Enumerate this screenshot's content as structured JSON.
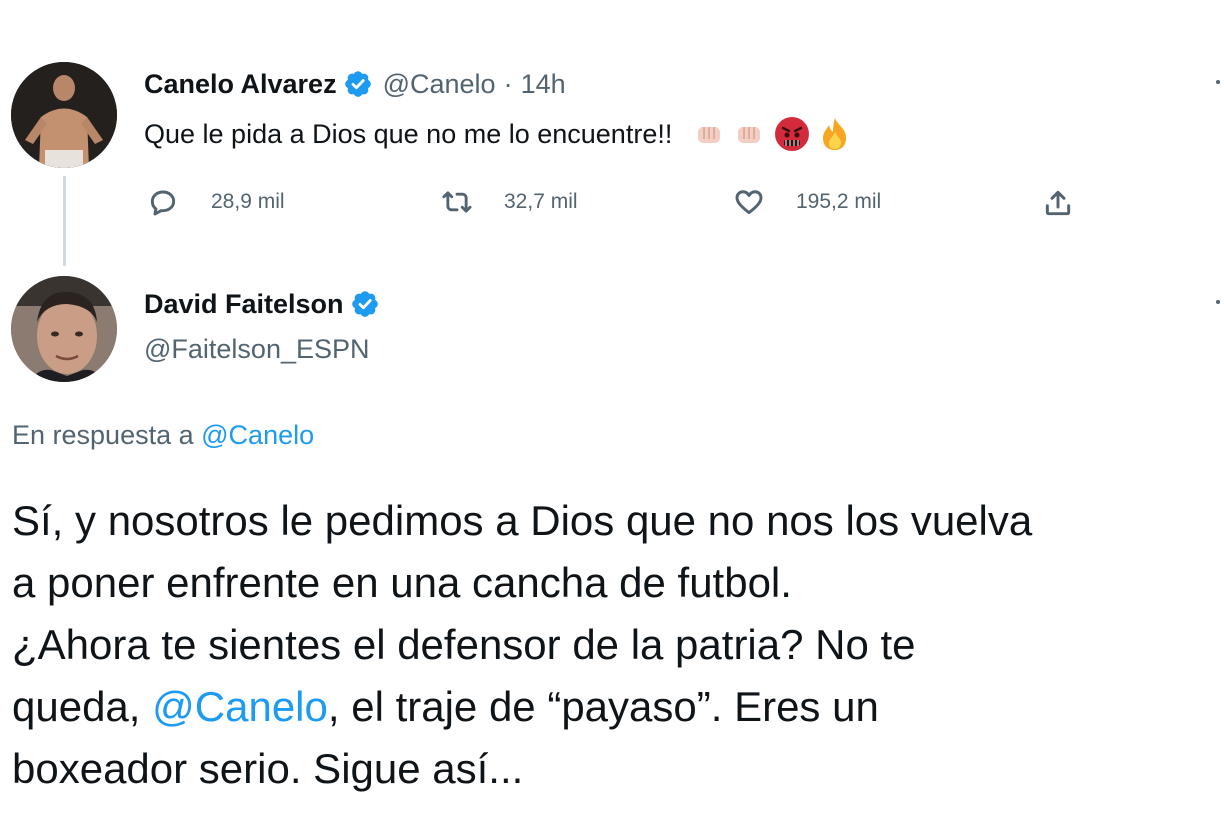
{
  "tweet1": {
    "display_name": "Canelo Alvarez",
    "handle": "@Canelo",
    "separator": "·",
    "time": "14h",
    "text": "Que le pida a Dios que no me lo encuentre!!",
    "emojis": [
      "fist-emoji",
      "fist-emoji",
      "angry-face-emoji",
      "fire-emoji"
    ],
    "stats": {
      "replies": "28,9 mil",
      "retweets": "32,7 mil",
      "likes": "195,2 mil"
    }
  },
  "tweet2": {
    "display_name": "David Faitelson",
    "handle": "@Faitelson_ESPN",
    "reply_prefix": "En respuesta a",
    "reply_to": "@Canelo",
    "body": {
      "line1": "Sí, y nosotros le pedimos a Dios que no nos los vuelva",
      "line2": "a poner enfrente en una cancha de futbol.",
      "line3": "¿Ahora te sientes el defensor de la patria? No te",
      "line4_pre": "queda, ",
      "line4_mention": "@Canelo",
      "line4_post": ", el traje de “payaso”. Eres un",
      "line5": "boxeador serio. Sigue así..."
    }
  },
  "colors": {
    "link": "#1d9bf0",
    "secondary_text": "#536471",
    "primary_text": "#0f1419",
    "verified": "#1d9bf0"
  }
}
